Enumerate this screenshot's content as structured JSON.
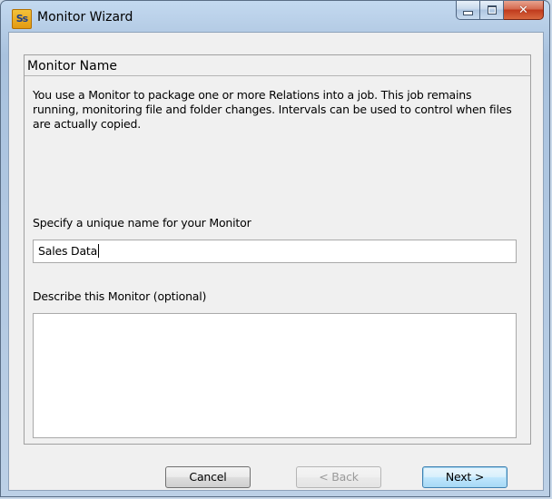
{
  "window": {
    "title": "Monitor Wizard",
    "icon_text": "Ss"
  },
  "panel": {
    "title": "Monitor Name",
    "description": "You use a Monitor to package one or more Relations into a job. This job remains running, monitoring file and folder changes. Intervals can be used to control when files are actually copied."
  },
  "fields": {
    "name_label": "Specify a unique name for your Monitor",
    "name_value": "Sales Data",
    "description_label": "Describe this Monitor (optional)",
    "description_value": ""
  },
  "buttons": {
    "cancel": "Cancel",
    "back": "< Back",
    "next": "Next >"
  },
  "colors": {
    "frame": "#b6cde6",
    "client_bg": "#f0f0f0",
    "close_button": "#c03a1d",
    "default_button_border": "#3c7fb1"
  }
}
